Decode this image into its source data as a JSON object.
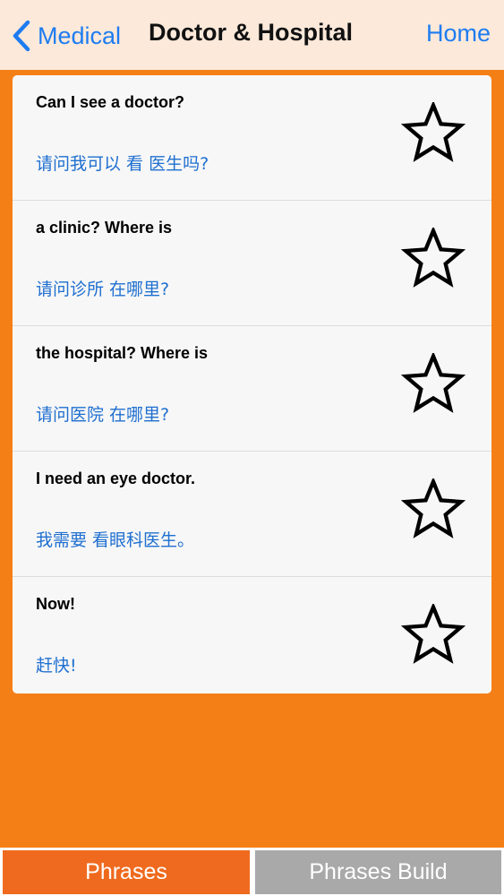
{
  "nav": {
    "back_label": "Medical",
    "title": "Doctor & Hospital",
    "home_label": "Home"
  },
  "phrases": [
    {
      "english": "Can I see a doctor?",
      "chinese": "请问我可以 看 医生吗?"
    },
    {
      "english": "a clinic? Where is",
      "chinese": "请问诊所 在哪里?"
    },
    {
      "english": "the hospital? Where is",
      "chinese": "请问医院 在哪里?"
    },
    {
      "english": "I need an eye doctor.",
      "chinese": "我需要 看眼科医生。"
    },
    {
      "english": "Now!",
      "chinese": "赶快!"
    }
  ],
  "tabs": {
    "phrases_label": "Phrases",
    "build_label": "Phrases Build"
  },
  "colors": {
    "accent_orange": "#F57F17",
    "nav_background": "#FCE9DA",
    "link_blue": "#1E7CF0",
    "chinese_text": "#1F6FD0",
    "tab_active": "#EF6A1E",
    "tab_inactive": "#A9A9A9"
  },
  "icons": {
    "back": "chevron-left-icon",
    "favorite": "star-outline-icon"
  }
}
